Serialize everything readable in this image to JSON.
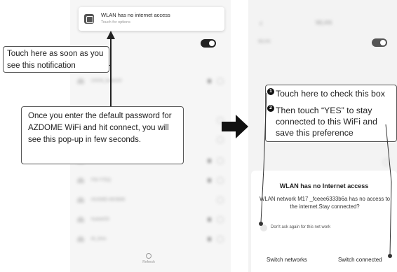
{
  "left_screen": {
    "notification": {
      "title": "WLAN has no internet access",
      "subtitle": "Touch for options"
    },
    "network_rows": [
      {
        "name": "CHUN_fuwe123"
      },
      {
        "name": ""
      },
      {
        "name": ""
      },
      {
        "name": ""
      },
      {
        "name": "FW-YTDQ"
      },
      {
        "name": "HUAWEI-4KHB46"
      },
      {
        "name": "huawei33"
      },
      {
        "name": "kk_bma"
      }
    ],
    "refresh_label": "Refresh"
  },
  "right_screen": {
    "header_title": "WLAN",
    "wlan_label": "WLAN",
    "dialog": {
      "title": "WLAN has no Internet access",
      "message": "WLAN network M17 _fceee6333b6a has no access to the internet.Stay connected?",
      "checkbox_label": "Don't ask again for this net work",
      "switch_networks": "Switch networks",
      "switch_connected": "Switch connected"
    }
  },
  "annotations": {
    "touch_notification": "Touch here as soon as you see this notification",
    "password_hint": "Once you enter the default password for AZDOME WiFi and hit connect, you will see this pop-up in few seconds.",
    "step1": "Touch here to check this box",
    "step2": "Then touch “YES” to stay connected to this WiFi and save this preference",
    "step1_number": "1",
    "step2_number": "2"
  },
  "colors": {
    "annotation_border": "#555555",
    "arrow": "#111111",
    "toggle": "#222222"
  }
}
